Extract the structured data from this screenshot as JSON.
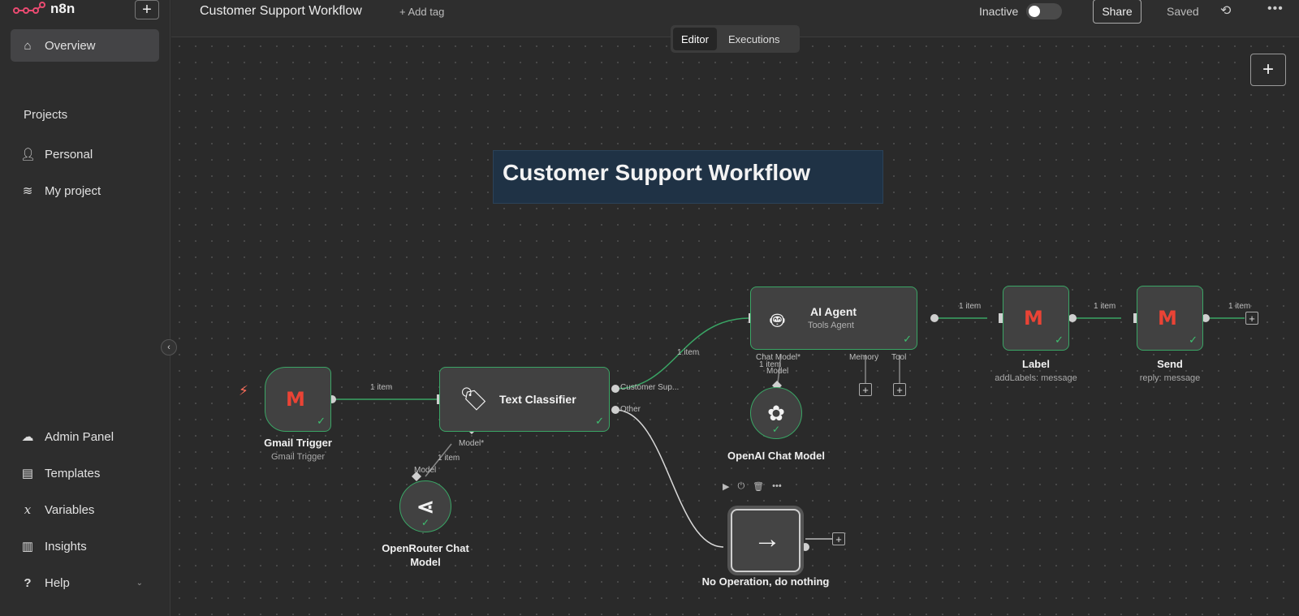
{
  "brand": {
    "name": "n8n"
  },
  "sidebar": {
    "new_button": "+",
    "overview": "Overview",
    "projects_title": "Projects",
    "personal": "Personal",
    "my_project": "My project",
    "admin_panel": "Admin Panel",
    "templates": "Templates",
    "variables": "Variables",
    "insights": "Insights",
    "help": "Help"
  },
  "header": {
    "workflow_name": "Customer Support Workflow",
    "add_tag": "+ Add tag",
    "status": "Inactive",
    "share": "Share",
    "saved": "Saved"
  },
  "tabs": [
    "Editor",
    "Executions"
  ],
  "canvas": {
    "sticky_title": "Customer Support Workflow",
    "nodes": {
      "gmail_trigger": {
        "title": "Gmail Trigger",
        "subtitle": "Gmail Trigger"
      },
      "text_classifier": {
        "title": "Text Classifier",
        "out1": "Customer Sup...",
        "out2": "Other",
        "in_model": "Model*"
      },
      "openrouter": {
        "title_line1": "OpenRouter Chat",
        "title_line2": "Model",
        "port": "Model"
      },
      "ai_agent": {
        "title": "AI Agent",
        "subtitle": "Tools Agent",
        "port_chat": "Chat Model*",
        "port_memory": "Memory",
        "port_tool": "Tool"
      },
      "openai": {
        "title": "OpenAI Chat Model",
        "port": "Model"
      },
      "label": {
        "title": "Label",
        "subtitle": "addLabels: message"
      },
      "send": {
        "title": "Send",
        "subtitle": "reply: message"
      },
      "noop": {
        "title": "No Operation, do nothing"
      }
    },
    "edge_labels": {
      "trigger_to_classifier": "1 item",
      "classifier_to_agent": "1 item",
      "model_to_classifier": "1 item",
      "openai_to_agent": "1 item",
      "agent_to_label": "1 item",
      "label_to_send": "1 item",
      "send_out": "1 item"
    }
  },
  "colors": {
    "success": "#3aa565",
    "trigger": "#ff6d5a",
    "sticky": "#1f3245"
  }
}
